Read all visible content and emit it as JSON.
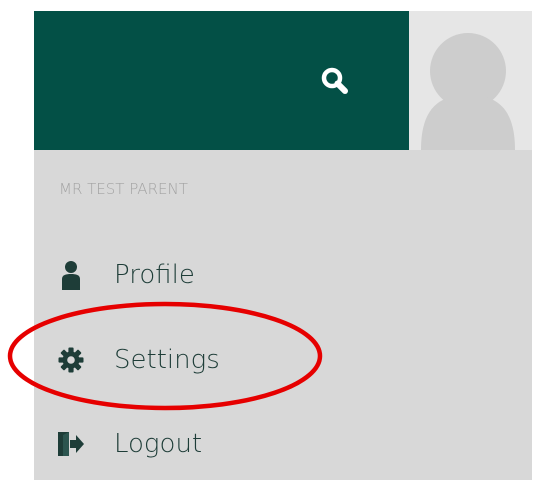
{
  "header": {
    "background": "#035046",
    "search_icon": "search-icon"
  },
  "avatar": {
    "icon": "user-avatar-icon"
  },
  "menu": {
    "user_name": "MR TEST PARENT",
    "items": [
      {
        "label": "Profile",
        "icon": "person-icon"
      },
      {
        "label": "Settings",
        "icon": "gear-icon"
      },
      {
        "label": "Logout",
        "icon": "logout-icon"
      }
    ]
  },
  "annotation": {
    "color": "#e60000",
    "target": "Settings"
  }
}
